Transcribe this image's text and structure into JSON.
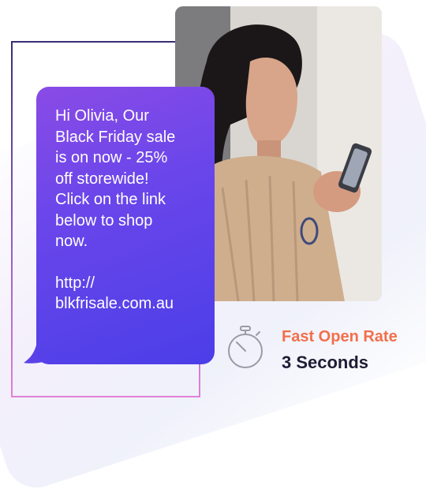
{
  "message": {
    "lines": [
      "Hi Olivia, Our",
      "Black Friday sale",
      "is on now - 25%",
      "off storewide!",
      "Click on the link",
      "below to shop",
      "now."
    ],
    "link_lines": [
      "http://",
      "blkfrisale.com.au"
    ]
  },
  "stat": {
    "label": "Fast Open Rate",
    "value": "3 Seconds",
    "icon": "stopwatch-icon"
  },
  "colors": {
    "bubble_start": "#8a4be6",
    "bubble_end": "#4b3ee8",
    "stat_label": "#f26f4b",
    "stat_value": "#1d1d35"
  }
}
